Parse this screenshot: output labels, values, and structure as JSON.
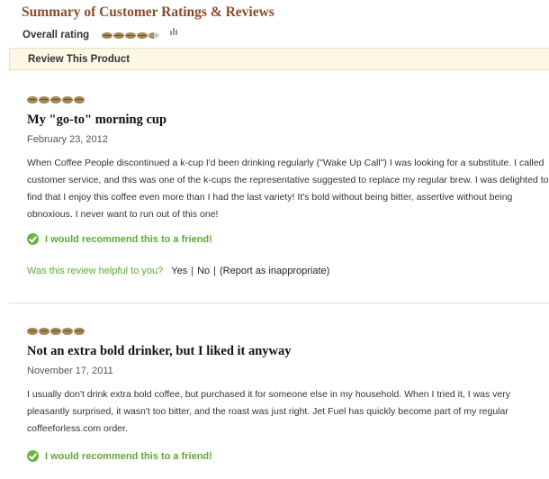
{
  "summary": {
    "title": "Summary of Customer Ratings & Reviews",
    "overall_label": "Overall rating",
    "overall_rating": 4.5,
    "max_rating": 5,
    "rating_icon": "coffee-bean-icon",
    "histogram_icon": "bar-chart-icon"
  },
  "review_bar": {
    "label": "Review This Product"
  },
  "colors": {
    "title_brown": "#8c4a2e",
    "bean_brown": "#a48656",
    "recommend_green": "#5ea836",
    "bar_background": "#fdf8e6"
  },
  "reviews": [
    {
      "rating": 5,
      "title": "My \"go-to\" morning cup",
      "date": "February 23, 2012",
      "body": "When Coffee People discontinued a k-cup I'd been drinking regularly (\"Wake Up Call\") I was looking for a substitute. I called customer service, and this was one of the k-cups the representative suggested to replace my regular brew. I was delighted to find that I enjoy this coffee even more than I had the last variety! It's bold without being bitter, assertive without being obnoxious. I never want to run out of this one!",
      "recommend": "I would recommend this to a friend!",
      "helpful_question": "Was this review helpful to you?",
      "yes_label": "Yes",
      "no_label": "No",
      "report_label": "(Report as inappropriate)"
    },
    {
      "rating": 5,
      "title": "Not an extra bold drinker, but I liked it anyway",
      "date": "November 17, 2011",
      "body": "I usually don't drink extra bold coffee, but purchased it for someone else in my household. When I tried it, I was very pleasantly surprised, it wasn't too bitter, and the roast was just right. Jet Fuel has quickly become part of my regular coffeeforless.com order.",
      "recommend": "I would recommend this to a friend!"
    }
  ]
}
